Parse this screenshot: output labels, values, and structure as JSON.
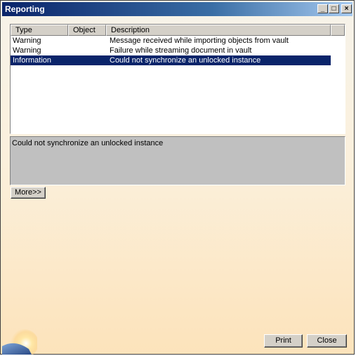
{
  "window": {
    "title": "Reporting",
    "minimize_glyph": "_",
    "maximize_glyph": "□",
    "close_glyph": "×"
  },
  "list": {
    "columns": [
      "Type",
      "Object",
      "Description"
    ],
    "rows": [
      {
        "type": "Warning",
        "object": "",
        "description": "Message received while importing objects from vault",
        "selected": false
      },
      {
        "type": "Warning",
        "object": "",
        "description": "Failure while streaming document in vault",
        "selected": false
      },
      {
        "type": "Information",
        "object": "",
        "description": "Could not synchronize an unlocked instance",
        "selected": true
      }
    ]
  },
  "details": {
    "text": "Could not synchronize an unlocked instance"
  },
  "buttons": {
    "more": "More>>",
    "print": "Print",
    "close": "Close"
  },
  "colors": {
    "titlebar_start": "#0a246a",
    "selection": "#0a246a",
    "details_bg": "#c0c0c0"
  },
  "icons": {
    "corner": "globe-icon"
  }
}
